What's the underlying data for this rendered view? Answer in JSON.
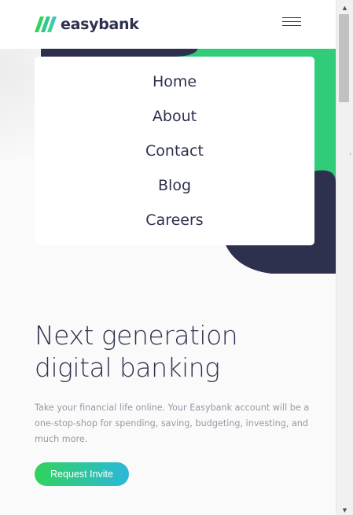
{
  "brand": {
    "name": "easybank",
    "colors": {
      "navy": "#2d314d",
      "green": "#31d35c",
      "cyan": "#2bb7da",
      "text_gray": "#9698a6"
    }
  },
  "header": {
    "logo_icon": "easybank-logo-icon",
    "menu_icon": "hamburger-icon"
  },
  "nav_menu": {
    "items": [
      {
        "label": "Home"
      },
      {
        "label": "About"
      },
      {
        "label": "Contact"
      },
      {
        "label": "Blog"
      },
      {
        "label": "Careers"
      }
    ]
  },
  "hero": {
    "headline_line1": "Next generation",
    "headline_line2": "digital banking",
    "description": "Take your financial life online. Your Easybank account will be a one-stop-shop for spending, saving, budgeting, investing, and much more.",
    "cta_label": "Request Invite"
  },
  "scrollbar": {
    "up_icon": "scroll-up-arrow-icon",
    "down_icon": "scroll-down-arrow-icon"
  }
}
